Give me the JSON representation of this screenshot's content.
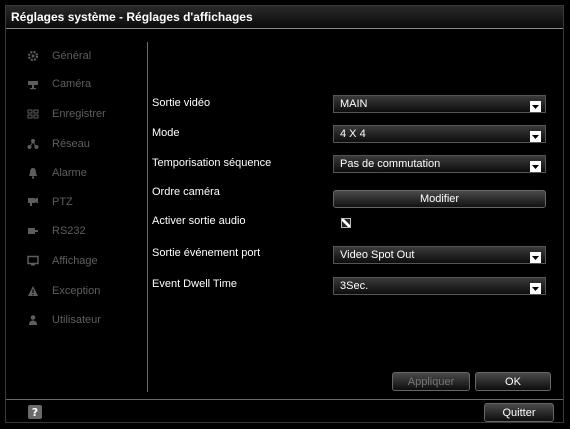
{
  "window": {
    "title": "Réglages système - Réglages d'affichages"
  },
  "sidebar": {
    "items": [
      {
        "label": "Général",
        "icon": "gear-icon"
      },
      {
        "label": "Caméra",
        "icon": "camera-icon"
      },
      {
        "label": "Enregistrer",
        "icon": "record-icon"
      },
      {
        "label": "Réseau",
        "icon": "network-icon"
      },
      {
        "label": "Alarme",
        "icon": "alarm-icon"
      },
      {
        "label": "PTZ",
        "icon": "ptz-icon"
      },
      {
        "label": "RS232",
        "icon": "serial-port-icon"
      },
      {
        "label": "Affichage",
        "icon": "monitor-icon"
      },
      {
        "label": "Exception",
        "icon": "warning-icon"
      },
      {
        "label": "Utilisateur",
        "icon": "user-icon"
      }
    ]
  },
  "form": {
    "video_output": {
      "label": "Sortie vidéo",
      "value": "MAIN"
    },
    "mode": {
      "label": "Mode",
      "value": "4 X 4"
    },
    "sequence_dwell": {
      "label": "Temporisation séquence",
      "value": "Pas de commutation"
    },
    "camera_order": {
      "label": "Ordre caméra",
      "button_label": "Modifier"
    },
    "audio_output": {
      "label": "Activer sortie audio",
      "checked": true
    },
    "event_output_port": {
      "label": "Sortie événement port",
      "value": "Video Spot Out"
    },
    "event_dwell_time": {
      "label": "Event Dwell Time",
      "value": "3Sec."
    }
  },
  "buttons": {
    "apply": "Appliquer",
    "ok": "OK",
    "quit": "Quitter"
  },
  "colors": {
    "background": "#000000",
    "text": "#ffffff",
    "disabled_text": "#5e5e5e"
  }
}
